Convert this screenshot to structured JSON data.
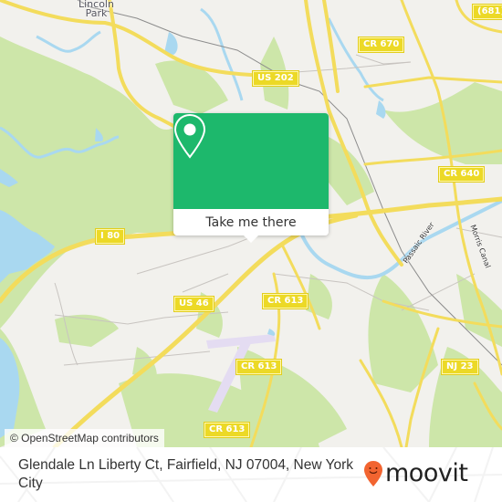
{
  "map": {
    "place_labels": [
      {
        "name": "lincoln-park",
        "text_line1": "Lincoln",
        "text_line2": "Park"
      }
    ],
    "road_shields": [
      {
        "id": "i80",
        "text": "I 80"
      },
      {
        "id": "us202",
        "text": "US 202"
      },
      {
        "id": "cr670",
        "text": "CR 670"
      },
      {
        "id": "r681",
        "text": "(681)"
      },
      {
        "id": "cr640",
        "text": "CR 640"
      },
      {
        "id": "us46",
        "text": "US 46"
      },
      {
        "id": "cr613a",
        "text": "CR 613"
      },
      {
        "id": "cr613b",
        "text": "CR 613"
      },
      {
        "id": "cr613c",
        "text": "CR 613"
      },
      {
        "id": "nj23",
        "text": "NJ 23"
      }
    ],
    "waterway_labels": [
      {
        "id": "passaic-river",
        "text": "Passaic River"
      },
      {
        "id": "morris-canal",
        "text": "Morris Canal"
      }
    ],
    "colors": {
      "land": "#f2f1ed",
      "park": "#cde6a9",
      "water": "#a9d8f0",
      "road": "#f3dc5c",
      "airport": "#e4dcf2"
    },
    "attribution": "© OpenStreetMap contributors"
  },
  "popup": {
    "icon": "location-pin-icon",
    "action_label": "Take me there",
    "color": "#1db86c"
  },
  "footer": {
    "address": "Glendale Ln Liberty Ct, Fairfield, NJ 07004, New York City",
    "brand": "moovit",
    "brand_color": "#f26430"
  }
}
